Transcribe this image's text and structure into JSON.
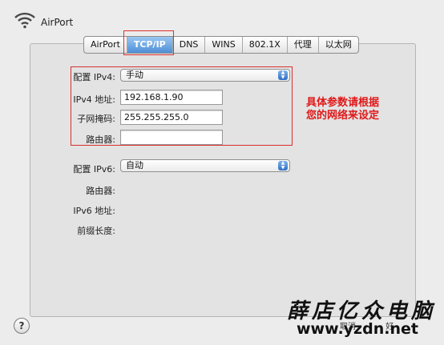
{
  "window": {
    "title": "AirPort"
  },
  "tabs": [
    {
      "label": "AirPort",
      "active": false
    },
    {
      "label": "TCP/IP",
      "active": true
    },
    {
      "label": "DNS",
      "active": false
    },
    {
      "label": "WINS",
      "active": false
    },
    {
      "label": "802.1X",
      "active": false
    },
    {
      "label": "代理",
      "active": false
    },
    {
      "label": "以太网",
      "active": false
    }
  ],
  "ipv4": {
    "configure_label": "配置 IPv4:",
    "configure_value": "手动",
    "address_label": "IPv4 地址:",
    "address_value": "192.168.1.90",
    "subnet_label": "子网掩码:",
    "subnet_value": "255.255.255.0",
    "router_label": "路由器:",
    "router_value": ""
  },
  "annotation": {
    "line1": "具体参数请根据",
    "line2": "您的网络来设定"
  },
  "ipv6": {
    "configure_label": "配置 IPv6:",
    "configure_value": "自动",
    "router_label": "路由器:",
    "address_label": "IPv6 地址:",
    "prefix_label": "前缀长度:"
  },
  "footer": {
    "help": "?",
    "cancel_label": "取消",
    "ok_label": "好"
  },
  "watermark": {
    "line1": "薛店亿众电脑",
    "line2": "www.yzdn.net"
  },
  "colors": {
    "accent": "#4f8fd6",
    "highlight_red": "#e01818"
  }
}
